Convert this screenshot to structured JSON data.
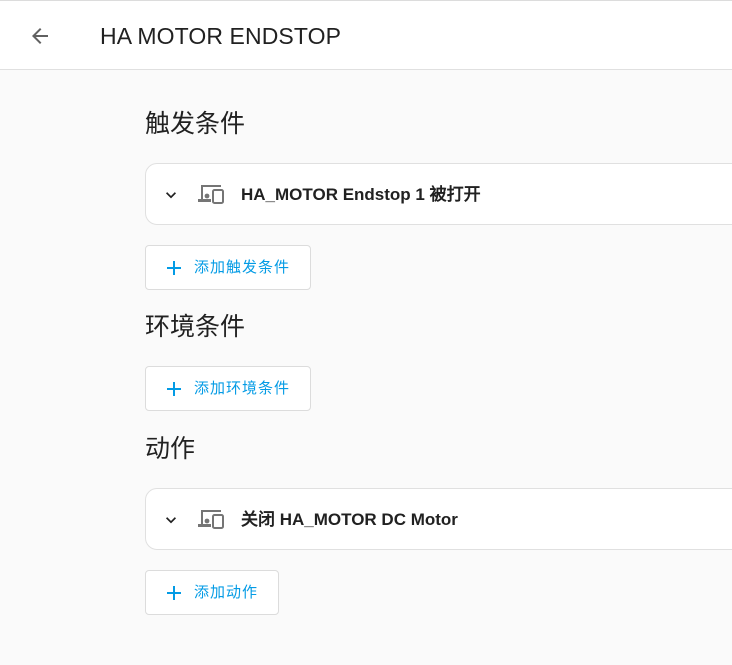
{
  "header": {
    "title": "HA MOTOR ENDSTOP",
    "back_icon": "arrow-left-icon"
  },
  "triggers": {
    "heading": "触发条件",
    "items": [
      {
        "label": "HA_MOTOR Endstop 1 被打开",
        "icon": "device-icon",
        "toggle_icon": "chevron-down-icon"
      }
    ],
    "add_label": "添加触发条件"
  },
  "conditions": {
    "heading": "环境条件",
    "items": [],
    "add_label": "添加环境条件"
  },
  "actions": {
    "heading": "动作",
    "items": [
      {
        "label": "关闭 HA_MOTOR DC Motor",
        "icon": "device-icon",
        "toggle_icon": "chevron-down-icon"
      }
    ],
    "add_label": "添加动作"
  },
  "colors": {
    "accent": "#039be5",
    "text": "#212121",
    "icon": "#616161",
    "background": "#fafafa"
  }
}
